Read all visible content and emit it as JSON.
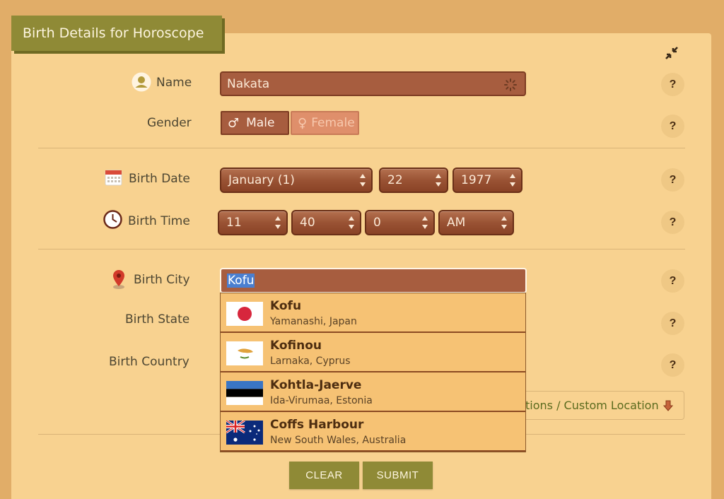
{
  "header": {
    "title": "Birth Details for Horoscope"
  },
  "icons": {
    "collapse": "compress-icon",
    "name": "user-icon",
    "birth_date": "calendar-icon",
    "birth_time": "clock-icon",
    "birth_city": "map-pin-icon",
    "help": "question-icon",
    "more": "arrow-down-icon"
  },
  "colors": {
    "accent": "#8f8a36",
    "field": "#a75d3f",
    "background": "#e1ad68",
    "card": "#f8d290"
  },
  "form": {
    "name": {
      "label": "Name",
      "value": "Nakata"
    },
    "gender": {
      "label": "Gender",
      "male": "Male",
      "female": "Female",
      "male_symbol": "♂",
      "female_symbol": "♀",
      "selected": "Male"
    },
    "birth_date": {
      "label": "Birth Date",
      "month": "January (1)",
      "day": "22",
      "year": "1977"
    },
    "birth_time": {
      "label": "Birth Time",
      "hour": "11",
      "minute": "40",
      "second": "0",
      "ampm": "AM"
    },
    "birth_city": {
      "label": "Birth City",
      "value": "Kofu"
    },
    "birth_state": {
      "label": "Birth State"
    },
    "birth_country": {
      "label": "Birth Country"
    },
    "more_locations": "tions / Custom Location",
    "help_label": "?"
  },
  "suggestions": [
    {
      "name": "Kofu",
      "region": "Yamanashi, Japan",
      "flag": "japan"
    },
    {
      "name": "Kofinou",
      "region": "Larnaka, Cyprus",
      "flag": "cyprus"
    },
    {
      "name": "Kohtla-Jaerve",
      "region": "Ida-Virumaa, Estonia",
      "flag": "estonia"
    },
    {
      "name": "Coffs Harbour",
      "region": "New South Wales, Australia",
      "flag": "australia"
    }
  ],
  "actions": {
    "clear": "CLEAR",
    "submit": "SUBMIT"
  }
}
